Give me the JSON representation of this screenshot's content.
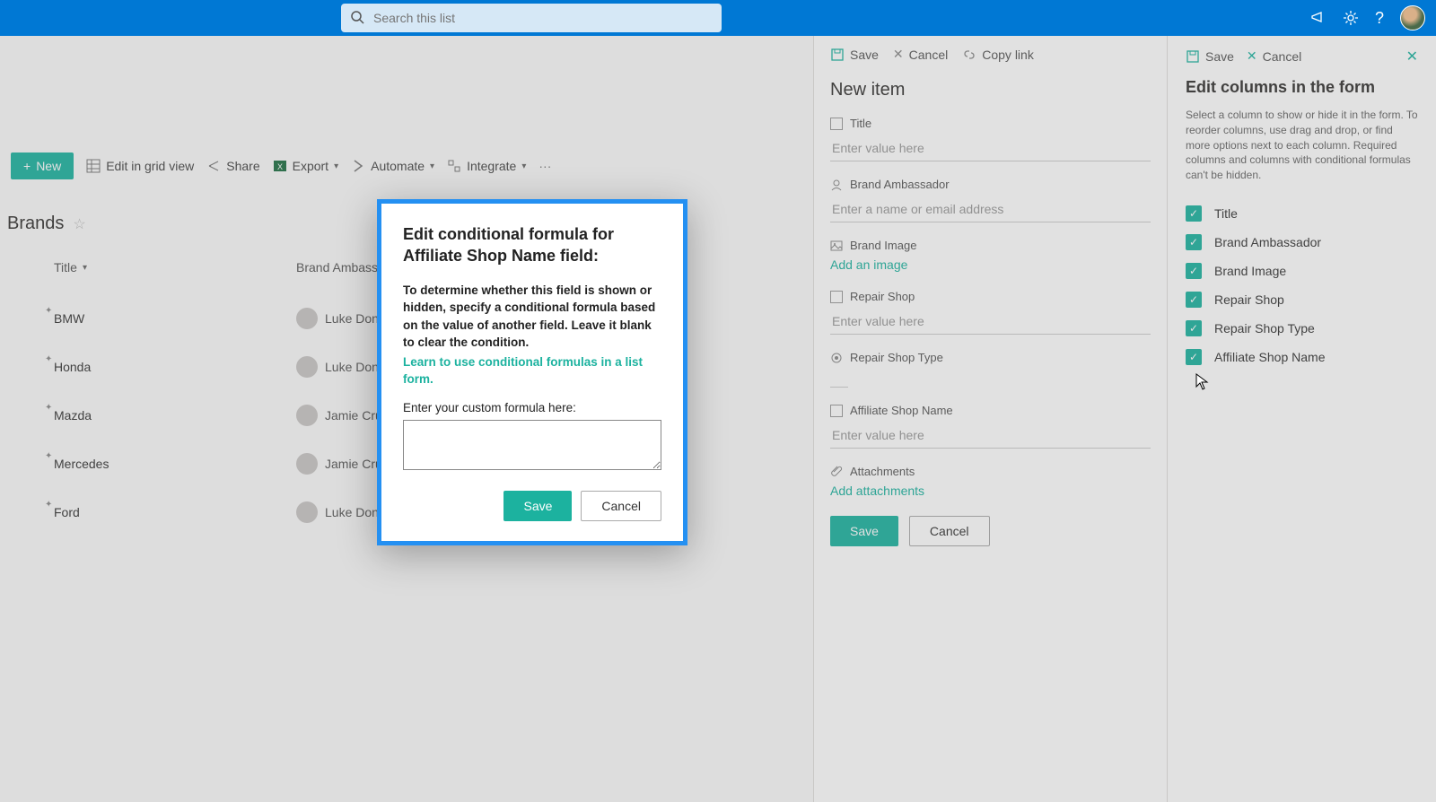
{
  "header": {
    "search_placeholder": "Search this list"
  },
  "toolbar": {
    "new_label": "New",
    "edit_grid_label": "Edit in grid view",
    "share_label": "Share",
    "export_label": "Export",
    "automate_label": "Automate",
    "integrate_label": "Integrate"
  },
  "list": {
    "title": "Brands",
    "columns": {
      "title": "Title",
      "brand_amb": "Brand Ambass..."
    },
    "rows": [
      {
        "title": "BMW",
        "person": "Luke Donald"
      },
      {
        "title": "Honda",
        "person": "Luke Donald"
      },
      {
        "title": "Mazda",
        "person": "Jamie Crust"
      },
      {
        "title": "Mercedes",
        "person": "Jamie Crust"
      },
      {
        "title": "Ford",
        "person": "Luke Donald"
      }
    ]
  },
  "form": {
    "toolbar": {
      "save": "Save",
      "cancel": "Cancel",
      "copy": "Copy link"
    },
    "title": "New item",
    "fields": {
      "title": {
        "label": "Title",
        "placeholder": "Enter value here"
      },
      "brand_amb": {
        "label": "Brand Ambassador",
        "placeholder": "Enter a name or email address"
      },
      "brand_img": {
        "label": "Brand Image",
        "action": "Add an image"
      },
      "repair_shop": {
        "label": "Repair Shop",
        "placeholder": "Enter value here"
      },
      "repair_shop_type": {
        "label": "Repair Shop Type"
      },
      "affiliate": {
        "label": "Affiliate Shop Name",
        "placeholder": "Enter value here"
      },
      "attachments": {
        "label": "Attachments",
        "action": "Add attachments"
      }
    },
    "save": "Save",
    "cancel": "Cancel"
  },
  "cols_panel": {
    "save": "Save",
    "cancel": "Cancel",
    "title": "Edit columns in the form",
    "desc": "Select a column to show or hide it in the form. To reorder columns, use drag and drop, or find more options next to each column. Required columns and columns with conditional formulas can't be hidden.",
    "items": [
      "Title",
      "Brand Ambassador",
      "Brand Image",
      "Repair Shop",
      "Repair Shop Type",
      "Affiliate Shop Name"
    ]
  },
  "modal": {
    "title": "Edit conditional formula for Affiliate Shop Name field:",
    "text": "To determine whether this field is shown or hidden, specify a conditional formula based on the value of another field. Leave it blank to clear the condition.",
    "link": "Learn to use conditional formulas in a list form.",
    "input_label": "Enter your custom formula here:",
    "save": "Save",
    "cancel": "Cancel"
  }
}
